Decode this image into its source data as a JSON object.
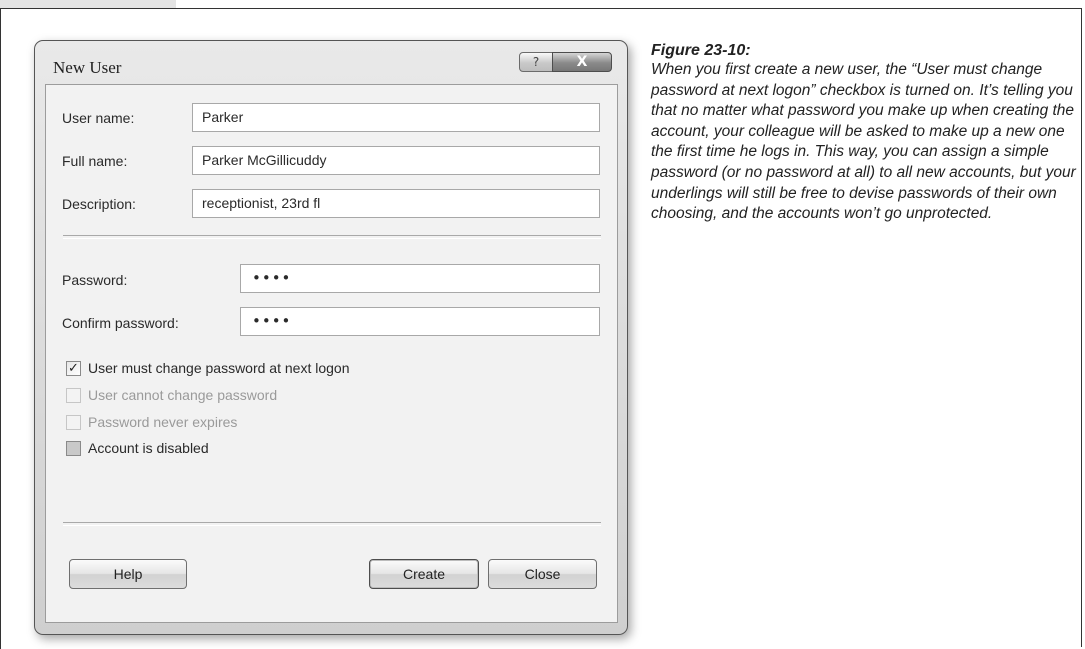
{
  "dialog": {
    "title": "New User",
    "help_caption": "?",
    "close_caption": "X",
    "fields": {
      "user_name": {
        "label": "User name:",
        "value": "Parker"
      },
      "full_name": {
        "label": "Full name:",
        "value": "Parker McGillicuddy"
      },
      "description": {
        "label": "Description:",
        "value": "receptionist, 23rd fl"
      },
      "password": {
        "label": "Password:",
        "value": "••••"
      },
      "confirm_password": {
        "label": "Confirm password:",
        "value": "••••"
      }
    },
    "checkboxes": [
      {
        "label": "User must change password at next logon",
        "checked": true,
        "enabled": true
      },
      {
        "label": "User cannot change password",
        "checked": false,
        "enabled": false
      },
      {
        "label": "Password never expires",
        "checked": false,
        "enabled": false
      },
      {
        "label": "Account is disabled",
        "checked": false,
        "enabled": true
      }
    ],
    "checkmark": "✓",
    "buttons": {
      "help": "Help",
      "create": "Create",
      "close": "Close"
    }
  },
  "caption": {
    "title": "Figure 23-10:",
    "body": "When you first create a new user, the “User must change password at next logon” checkbox is turned on. It’s telling you that no matter what password you make up when creating the account, your colleague will be asked to make up a new one the first time he logs in. This way, you can assign a simple password (or no password at all) to all new accounts, but your underlings will still be free to devise passwords of their own choosing, and the accounts won’t go unprotected."
  }
}
